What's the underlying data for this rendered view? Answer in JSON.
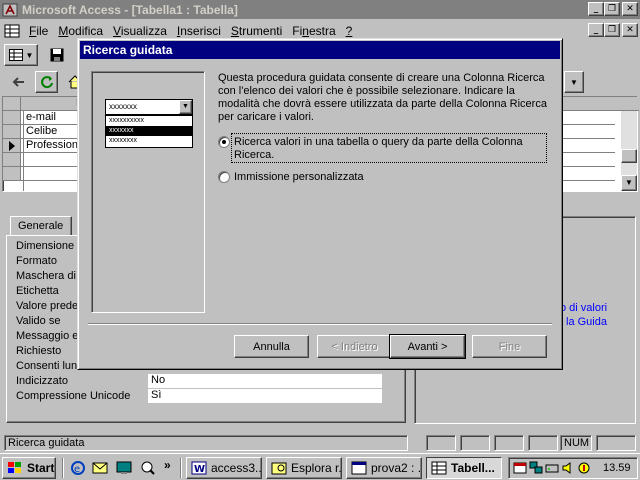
{
  "window": {
    "title": "Microsoft Access - [Tabella1 : Tabella]"
  },
  "menu": [
    {
      "pre": "",
      "u": "F",
      "post": "ile"
    },
    {
      "pre": "",
      "u": "M",
      "post": "odifica"
    },
    {
      "pre": "",
      "u": "V",
      "post": "isualizza"
    },
    {
      "pre": "",
      "u": "I",
      "post": "nserisci"
    },
    {
      "pre": "",
      "u": "S",
      "post": "trumenti"
    },
    {
      "pre": "Fi",
      "u": "n",
      "post": "estra"
    },
    {
      "pre": "",
      "u": "?",
      "post": ""
    }
  ],
  "grid": {
    "header": "No",
    "rows": [
      "e-mail",
      "Celibe",
      "Professione",
      "",
      "",
      ""
    ]
  },
  "props": {
    "tab_label": "Generale",
    "labels": [
      "Dimensione c",
      "Formato",
      "Maschera di",
      "Etichetta",
      "Valore prede",
      "Valido se",
      "Messaggio e",
      "Richiesto",
      "Consenti lun",
      "Indicizzato",
      "Compressione Unicode"
    ],
    "values": {
      "indicizzato": "No",
      "compressione": "Sì"
    },
    "help_lines": [
      "o di valori",
      "la Guida"
    ]
  },
  "dialog": {
    "title": "Ricerca guidata",
    "description": "Questa procedura guidata consente di creare una Colonna Ricerca con l'elenco dei valori che è possibile selezionare. Indicare la modalità che dovrà essere utilizzata da parte della Colonna Ricerca per caricare i valori.",
    "option1": "Ricerca valori in una tabella o query da parte della Colonna Ricerca.",
    "option2": "Immissione personalizzata",
    "preview_combo": "xxxxxxx",
    "preview_items": [
      "xxxxxxxxxx",
      "xxxxxxx",
      "xxxxxxxx"
    ],
    "buttons": {
      "annulla": "Annulla",
      "indietro": "< Indietro",
      "avanti": "Avanti >",
      "fine": "Fine"
    }
  },
  "status": {
    "text": "Ricerca guidata",
    "num": "NUM"
  },
  "taskbar": {
    "start": "Start",
    "quick_more": "»",
    "tasks": [
      "access3...",
      "Esplora r...",
      "prova2 : ...",
      "Tabell..."
    ],
    "clock": "13.59"
  }
}
